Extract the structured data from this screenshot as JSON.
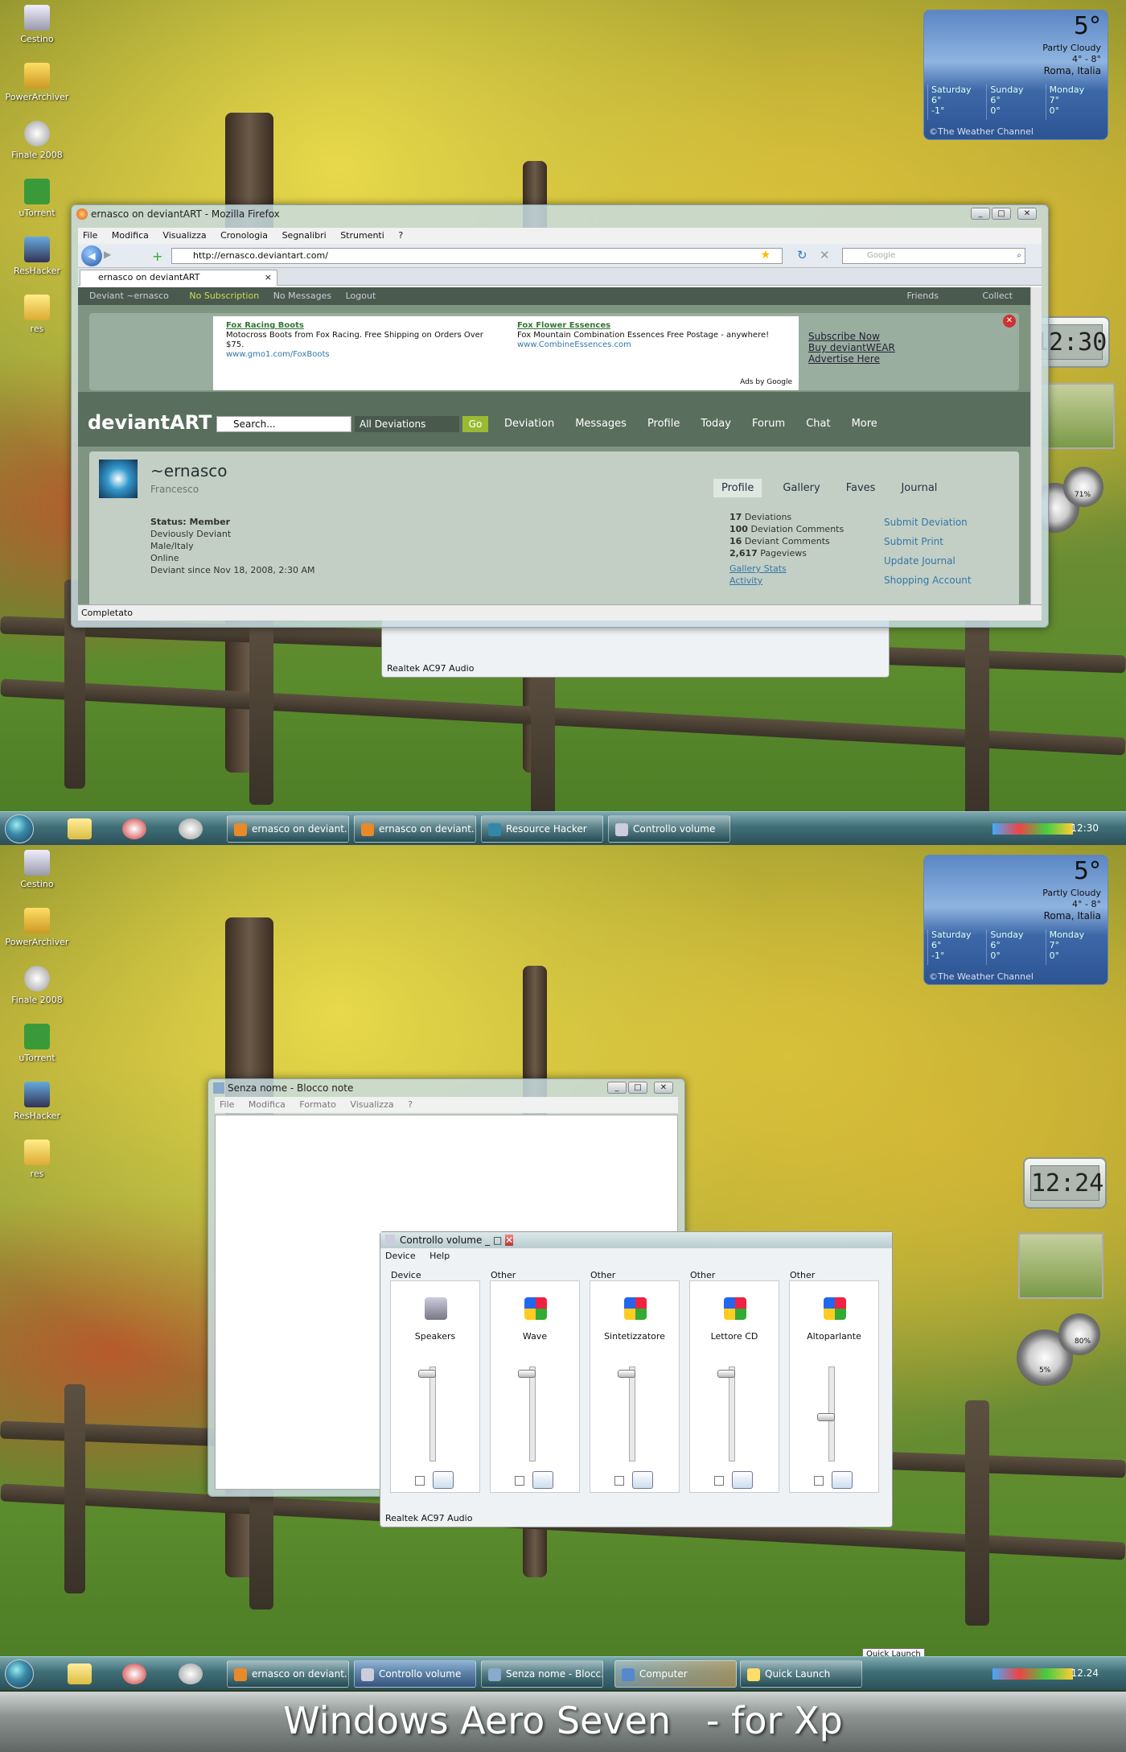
{
  "desktop_icons": [
    "Cestino",
    "PowerArchiver",
    "Finale 2008",
    "uTorrent",
    "ResHacker",
    "res"
  ],
  "weather": {
    "temp": "5°",
    "condition": "Partly Cloudy",
    "range": "4° - 8°",
    "location": "Roma, Italia",
    "days": [
      {
        "name": "Saturday",
        "hi": "6°",
        "lo": "-1°"
      },
      {
        "name": "Sunday",
        "hi": "6°",
        "lo": "0°"
      },
      {
        "name": "Monday",
        "hi": "7°",
        "lo": "0°"
      }
    ],
    "channel": "©The Weather Channel"
  },
  "top": {
    "clock": "12:30",
    "meters": [
      "71%"
    ],
    "firefox": {
      "title": "ernasco on deviantART - Mozilla Firefox",
      "menu": [
        "File",
        "Modifica",
        "Visualizza",
        "Cronologia",
        "Segnalibri",
        "Strumenti",
        "?"
      ],
      "url": "http://ernasco.deviantart.com/",
      "search_placeholder": "Google",
      "tab": "ernasco on deviantART",
      "status": "Completato",
      "da_bar": {
        "user": "Deviant ~ernasco",
        "sub": "No Subscription",
        "msgs": "No Messages",
        "logout": "Logout",
        "friends": "Friends",
        "collect": "Collect"
      },
      "ad": {
        "t1": "Fox Racing Boots",
        "d1": "Motocross Boots from Fox Racing. Free Shipping on Orders Over $75.",
        "u1": "www.gmo1.com/FoxBoots",
        "t2": "Fox Flower Essences",
        "d2": "Fox Mountain Combination Essences Free Postage - anywhere!",
        "u2": "www.CombineEssences.com",
        "adsby": "Ads by Google",
        "l1": "Subscribe Now",
        "l2": "Buy deviantWEAR",
        "l3": "Advertise Here"
      },
      "nav": {
        "logo": "deviantART",
        "search": "Search...",
        "scope": "All Deviations",
        "go": "Go",
        "items": [
          "Deviation",
          "Messages",
          "Profile",
          "Today",
          "Forum",
          "Chat",
          "More"
        ]
      },
      "profile": {
        "name": "~ernasco",
        "real": "Francesco",
        "tabs": [
          "Profile",
          "Gallery",
          "Faves",
          "Journal"
        ],
        "status": "Status: Member",
        "lines": [
          "Deviously Deviant",
          "Male/Italy",
          "Online",
          "Deviant since Nov 18, 2008, 2:30 AM"
        ],
        "stats": [
          {
            "n": "17",
            "l": "Deviations"
          },
          {
            "n": "100",
            "l": "Deviation Comments"
          },
          {
            "n": "16",
            "l": "Deviant Comments"
          },
          {
            "n": "2,617",
            "l": "Pageviews"
          }
        ],
        "gallery_stats": "Gallery Stats",
        "activity": "Activity",
        "actions": [
          "Submit Deviation",
          "Submit Print",
          "Update Journal",
          "Shopping Account"
        ]
      }
    },
    "volume_footer": "Realtek AC97 Audio",
    "taskbar": {
      "tasks": [
        "ernasco on deviant...",
        "ernasco on deviant...",
        "Resource Hacker",
        "Controllo volume"
      ],
      "time": "12:30"
    }
  },
  "bottom": {
    "clock": "12:24",
    "meters": [
      "5%",
      "80%"
    ],
    "notepad": {
      "title": "Senza nome - Blocco note",
      "menu": [
        "File",
        "Modifica",
        "Formato",
        "Visualizza",
        "?"
      ]
    },
    "volume": {
      "title": "Controllo volume",
      "menu": [
        "Device",
        "Help"
      ],
      "footer": "Realtek AC97 Audio",
      "channels": [
        {
          "head": "Device",
          "name": "Speakers",
          "level": 0.95
        },
        {
          "head": "Other",
          "name": "Wave",
          "level": 0.95
        },
        {
          "head": "Other",
          "name": "Sintetizzatore",
          "level": 0.95
        },
        {
          "head": "Other",
          "name": "Lettore CD",
          "level": 0.95
        },
        {
          "head": "Other",
          "name": "Altoparlante",
          "level": 0.5
        }
      ]
    },
    "tooltip": "Quick Launch",
    "taskbar": {
      "tasks": [
        "ernasco on deviant...",
        "Controllo volume",
        "Senza nome - Blocc...",
        "Computer",
        "Quick Launch"
      ],
      "time": "12.24"
    }
  },
  "banner": "Windows Aero Seven   - for Xp"
}
